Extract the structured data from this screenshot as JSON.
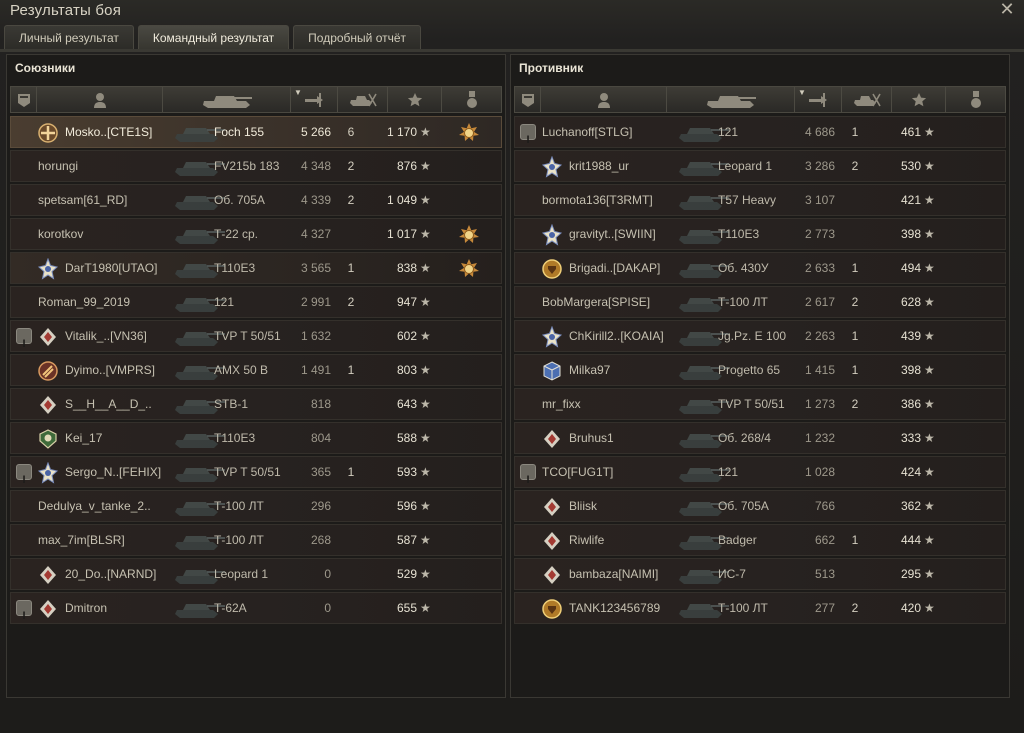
{
  "window": {
    "title": "Результаты боя",
    "close_icon": "close-icon"
  },
  "tabs": [
    {
      "label": "Личный результат",
      "active": false
    },
    {
      "label": "Командный результат",
      "active": true
    },
    {
      "label": "Подробный отчёт",
      "active": false
    }
  ],
  "columns": {
    "icons": [
      "platoon-icon",
      "player-icon",
      "tank-icon",
      "damage-icon",
      "frags-icon",
      "xp-star-icon",
      "medal-icon"
    ],
    "sorted_by": "damage"
  },
  "star_glyph": "★",
  "allies": {
    "title": "Союзники",
    "rows": [
      {
        "name": "Mosko..[CTE1S]",
        "tank": "Foch 155",
        "damage": "5 266",
        "frags": "6",
        "xp": "1 170",
        "platoon": false,
        "badge": "cross-medal",
        "medal": true,
        "me": true
      },
      {
        "name": "horungi",
        "tank": "FV215b 183",
        "damage": "4 348",
        "frags": "2",
        "xp": "876",
        "platoon": false,
        "badge": "",
        "medal": false
      },
      {
        "name": "spetsam[61_RD]",
        "tank": "Об. 705А",
        "damage": "4 339",
        "frags": "2",
        "xp": "1 049",
        "platoon": false,
        "badge": "",
        "medal": false
      },
      {
        "name": "korotkov",
        "tank": "Т-22 ср.",
        "damage": "4 327",
        "frags": "",
        "xp": "1 017",
        "platoon": false,
        "badge": "",
        "medal": true
      },
      {
        "name": "DarT1980[UTAO]",
        "tank": "T110E3",
        "damage": "3 565",
        "frags": "1",
        "xp": "838",
        "platoon": false,
        "badge": "star-badge",
        "medal": true,
        "squad": true
      },
      {
        "name": "Roman_99_2019",
        "tank": "121",
        "damage": "2 991",
        "frags": "2",
        "xp": "947",
        "platoon": false,
        "badge": "",
        "medal": false
      },
      {
        "name": "Vitalik_..[VN36]",
        "tank": "TVP T 50/51",
        "damage": "1 632",
        "frags": "",
        "xp": "602",
        "platoon": true,
        "badge": "diamond-badge",
        "medal": false
      },
      {
        "name": "Dyimo..[VMPRS]",
        "tank": "AMX 50 B",
        "damage": "1 491",
        "frags": "1",
        "xp": "803",
        "platoon": false,
        "badge": "rank-badge",
        "medal": false
      },
      {
        "name": "S__H__A__D_..",
        "tank": "STB-1",
        "damage": "818",
        "frags": "",
        "xp": "643",
        "platoon": false,
        "badge": "diamond-badge",
        "medal": false
      },
      {
        "name": "Kei_17",
        "tank": "T110E3",
        "damage": "804",
        "frags": "",
        "xp": "588",
        "platoon": false,
        "badge": "green-badge",
        "medal": false
      },
      {
        "name": "Sergo_N..[FEHIX]",
        "tank": "TVP T 50/51",
        "damage": "365",
        "frags": "1",
        "xp": "593",
        "platoon": true,
        "badge": "star-badge",
        "medal": false
      },
      {
        "name": "Dedulya_v_tanke_2..",
        "tank": "Т-100 ЛТ",
        "damage": "296",
        "frags": "",
        "xp": "596",
        "platoon": false,
        "badge": "",
        "medal": false
      },
      {
        "name": "max_7im[BLSR]",
        "tank": "Т-100 ЛТ",
        "damage": "268",
        "frags": "",
        "xp": "587",
        "platoon": false,
        "badge": "",
        "medal": false
      },
      {
        "name": "20_Do..[NARND]",
        "tank": "Leopard 1",
        "damage": "0",
        "frags": "",
        "xp": "529",
        "platoon": false,
        "badge": "diamond-badge",
        "medal": false
      },
      {
        "name": "Dmitron",
        "tank": "Т-62А",
        "damage": "0",
        "frags": "",
        "xp": "655",
        "platoon": true,
        "badge": "diamond-badge",
        "medal": false
      }
    ]
  },
  "enemies": {
    "title": "Противник",
    "rows": [
      {
        "name": "Luchanoff[STLG]",
        "tank": "121",
        "damage": "4 686",
        "frags": "1",
        "xp": "461",
        "platoon": true,
        "badge": "",
        "medal": false
      },
      {
        "name": "krit1988_ur",
        "tank": "Leopard 1",
        "damage": "3 286",
        "frags": "2",
        "xp": "530",
        "platoon": false,
        "badge": "star-badge",
        "medal": false
      },
      {
        "name": "bormota136[T3RMT]",
        "tank": "T57 Heavy",
        "damage": "3 107",
        "frags": "",
        "xp": "421",
        "platoon": false,
        "badge": "",
        "medal": false
      },
      {
        "name": "gravityt..[SWIIN]",
        "tank": "T110E3",
        "damage": "2 773",
        "frags": "",
        "xp": "398",
        "platoon": false,
        "badge": "star-badge",
        "medal": false
      },
      {
        "name": "Brigadi..[DAKAP]",
        "tank": "Об. 430У",
        "damage": "2 633",
        "frags": "1",
        "xp": "494",
        "platoon": false,
        "badge": "gold-badge",
        "medal": false
      },
      {
        "name": "BobMargera[SPISE]",
        "tank": "Т-100 ЛТ",
        "damage": "2 617",
        "frags": "2",
        "xp": "628",
        "platoon": false,
        "badge": "",
        "medal": false
      },
      {
        "name": "ChKirill2..[KOAIA]",
        "tank": "Jg.Pz. E 100",
        "damage": "2 263",
        "frags": "1",
        "xp": "439",
        "platoon": false,
        "badge": "star-badge",
        "medal": false
      },
      {
        "name": "Milka97",
        "tank": "Progetto 65",
        "damage": "1 415",
        "frags": "1",
        "xp": "398",
        "platoon": false,
        "badge": "cube-badge",
        "medal": false
      },
      {
        "name": "mr_fixx",
        "tank": "TVP T 50/51",
        "damage": "1 273",
        "frags": "2",
        "xp": "386",
        "platoon": false,
        "badge": "",
        "medal": false
      },
      {
        "name": "Bruhus1",
        "tank": "Об. 268/4",
        "damage": "1 232",
        "frags": "",
        "xp": "333",
        "platoon": false,
        "badge": "diamond-badge",
        "medal": false
      },
      {
        "name": "TCO[FUG1T]",
        "tank": "121",
        "damage": "1 028",
        "frags": "",
        "xp": "424",
        "platoon": true,
        "badge": "",
        "medal": false
      },
      {
        "name": "Bliisk",
        "tank": "Об. 705А",
        "damage": "766",
        "frags": "",
        "xp": "362",
        "platoon": false,
        "badge": "diamond-badge",
        "medal": false
      },
      {
        "name": "Riwlife",
        "tank": "Badger",
        "damage": "662",
        "frags": "1",
        "xp": "444",
        "platoon": false,
        "badge": "diamond-badge",
        "medal": false
      },
      {
        "name": "bambaza[NAIMI]",
        "tank": "ИС-7",
        "damage": "513",
        "frags": "",
        "xp": "295",
        "platoon": false,
        "badge": "diamond-badge",
        "medal": false
      },
      {
        "name": "TANK123456789",
        "tank": "Т-100 ЛТ",
        "damage": "277",
        "frags": "2",
        "xp": "420",
        "platoon": false,
        "badge": "gold-badge",
        "medal": false
      }
    ]
  }
}
